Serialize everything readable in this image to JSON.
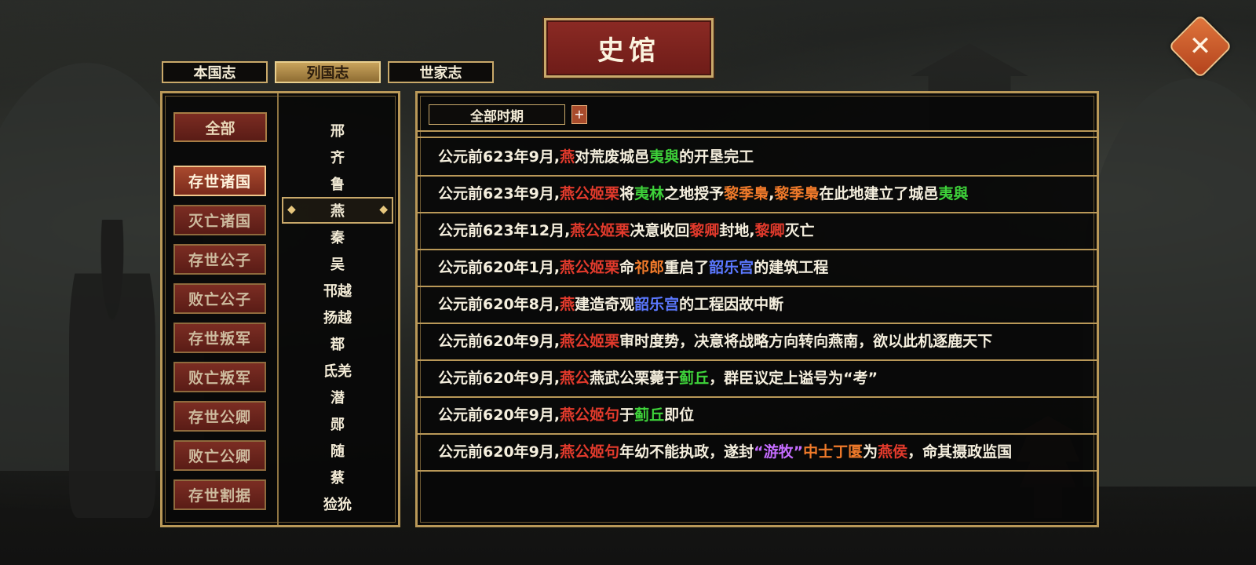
{
  "title": "史馆",
  "close_icon": "close-x-icon",
  "tabs": [
    {
      "label": "本国志",
      "active": false
    },
    {
      "label": "列国志",
      "active": true
    },
    {
      "label": "世家志",
      "active": false
    }
  ],
  "categories": {
    "all_label": "全部",
    "items": [
      {
        "label": "存世诸国",
        "active": true
      },
      {
        "label": "灭亡诸国",
        "active": false
      },
      {
        "label": "存世公子",
        "active": false
      },
      {
        "label": "败亡公子",
        "active": false
      },
      {
        "label": "存世叛军",
        "active": false
      },
      {
        "label": "败亡叛军",
        "active": false
      },
      {
        "label": "存世公卿",
        "active": false
      },
      {
        "label": "败亡公卿",
        "active": false
      },
      {
        "label": "存世割据",
        "active": false
      }
    ]
  },
  "states": [
    {
      "label": "邢",
      "active": false
    },
    {
      "label": "齐",
      "active": false
    },
    {
      "label": "鲁",
      "active": false
    },
    {
      "label": "燕",
      "active": true
    },
    {
      "label": "秦",
      "active": false
    },
    {
      "label": "吴",
      "active": false
    },
    {
      "label": "邗越",
      "active": false
    },
    {
      "label": "扬越",
      "active": false
    },
    {
      "label": "鄀",
      "active": false
    },
    {
      "label": "氐羌",
      "active": false
    },
    {
      "label": "潜",
      "active": false
    },
    {
      "label": "郧",
      "active": false
    },
    {
      "label": "随",
      "active": false
    },
    {
      "label": "蔡",
      "active": false
    },
    {
      "label": "猃狁",
      "active": false
    }
  ],
  "period": {
    "selected": "全部时期",
    "add_label": "+"
  },
  "colors": {
    "red": "#e23a2c",
    "orange": "#f07a2a",
    "green": "#3ed23a",
    "blue": "#5b78ff",
    "purple": "#c56cff",
    "gold": "#c9a96a"
  },
  "events": [
    {
      "segments": [
        {
          "t": "公元前623年9月,",
          "c": ""
        },
        {
          "t": "燕",
          "c": "red"
        },
        {
          "t": "对荒废城邑",
          "c": ""
        },
        {
          "t": "夷與",
          "c": "green"
        },
        {
          "t": "的开垦完工",
          "c": ""
        }
      ]
    },
    {
      "segments": [
        {
          "t": "公元前623年9月,",
          "c": ""
        },
        {
          "t": "燕公姬栗",
          "c": "red"
        },
        {
          "t": "将",
          "c": ""
        },
        {
          "t": "夷林",
          "c": "green"
        },
        {
          "t": "之地授予",
          "c": ""
        },
        {
          "t": "黎季梟",
          "c": "orange"
        },
        {
          "t": ",",
          "c": ""
        },
        {
          "t": "黎季梟",
          "c": "orange"
        },
        {
          "t": "在此地建立了城邑",
          "c": ""
        },
        {
          "t": "夷與",
          "c": "green"
        }
      ]
    },
    {
      "segments": [
        {
          "t": "公元前623年12月,",
          "c": ""
        },
        {
          "t": "燕公姬栗",
          "c": "red"
        },
        {
          "t": "决意收回",
          "c": ""
        },
        {
          "t": "黎卿",
          "c": "red"
        },
        {
          "t": "封地,",
          "c": ""
        },
        {
          "t": "黎卿",
          "c": "red"
        },
        {
          "t": "灭亡",
          "c": ""
        }
      ]
    },
    {
      "segments": [
        {
          "t": "公元前620年1月,",
          "c": ""
        },
        {
          "t": "燕公姬栗",
          "c": "red"
        },
        {
          "t": "命",
          "c": ""
        },
        {
          "t": "祁郎",
          "c": "orange"
        },
        {
          "t": "重启了",
          "c": ""
        },
        {
          "t": "韶乐宫",
          "c": "blue"
        },
        {
          "t": "的建筑工程",
          "c": ""
        }
      ]
    },
    {
      "segments": [
        {
          "t": "公元前620年8月,",
          "c": ""
        },
        {
          "t": "燕",
          "c": "red"
        },
        {
          "t": "建造奇观",
          "c": ""
        },
        {
          "t": "韶乐宫",
          "c": "blue"
        },
        {
          "t": "的工程因故中断",
          "c": ""
        }
      ]
    },
    {
      "segments": [
        {
          "t": "公元前620年9月,",
          "c": ""
        },
        {
          "t": "燕公姬栗",
          "c": "red"
        },
        {
          "t": "审时度势，决意将战略方向转向燕南，欲以此机逐鹿天下",
          "c": ""
        }
      ]
    },
    {
      "segments": [
        {
          "t": "公元前620年9月,",
          "c": ""
        },
        {
          "t": "燕公",
          "c": "red"
        },
        {
          "t": "燕武公栗薨于",
          "c": ""
        },
        {
          "t": "蓟丘",
          "c": "green"
        },
        {
          "t": "，群臣议定上谥号为“考”",
          "c": ""
        }
      ]
    },
    {
      "segments": [
        {
          "t": "公元前620年9月,",
          "c": ""
        },
        {
          "t": "燕公姬句",
          "c": "red"
        },
        {
          "t": "于",
          "c": ""
        },
        {
          "t": "蓟丘",
          "c": "green"
        },
        {
          "t": "即位",
          "c": ""
        }
      ]
    },
    {
      "segments": [
        {
          "t": "公元前620年9月,",
          "c": ""
        },
        {
          "t": "燕公姬句",
          "c": "red"
        },
        {
          "t": "年幼不能执政，遂封",
          "c": ""
        },
        {
          "t": "“游牧”",
          "c": "purple"
        },
        {
          "t": "中士丁匽",
          "c": "orange"
        },
        {
          "t": "为",
          "c": ""
        },
        {
          "t": "燕侯",
          "c": "red"
        },
        {
          "t": "，命其摄政监国",
          "c": ""
        }
      ]
    }
  ]
}
